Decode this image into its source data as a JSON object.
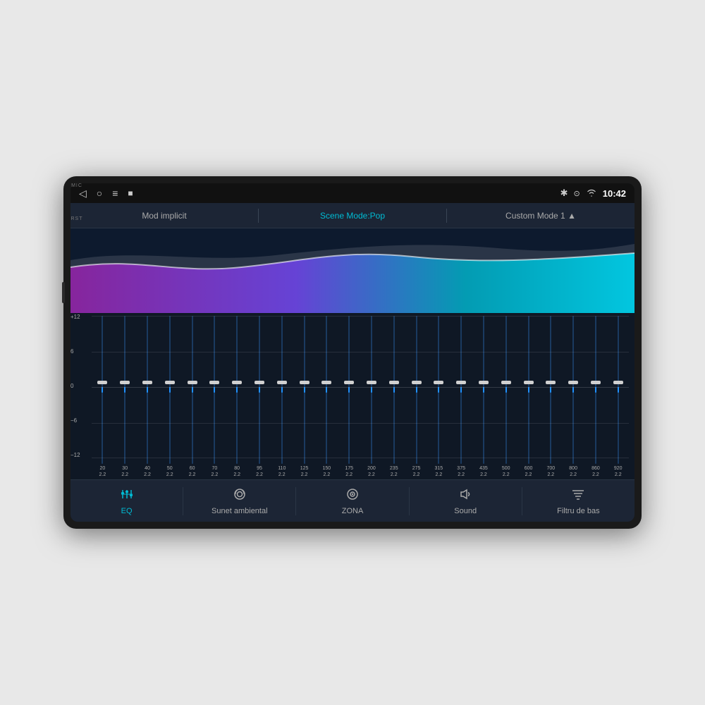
{
  "device": {
    "mic_label": "MIC",
    "rst_label": "RST"
  },
  "status_bar": {
    "time": "10:42",
    "icons": [
      "◁",
      "○",
      "≡",
      "■"
    ],
    "right_icons": [
      "✱",
      "⊙",
      "WiFi"
    ]
  },
  "mode_bar": {
    "items": [
      {
        "label": "Mod implicit",
        "active": false
      },
      {
        "label": "Scene Mode:Pop",
        "active": true
      },
      {
        "label": "Custom Mode 1 ▲",
        "active": false
      }
    ]
  },
  "eq_bands": [
    {
      "fc": "20",
      "q": "2.2",
      "level": 0.5
    },
    {
      "fc": "30",
      "q": "2.2",
      "level": 0.5
    },
    {
      "fc": "40",
      "q": "2.2",
      "level": 0.5
    },
    {
      "fc": "50",
      "q": "2.2",
      "level": 0.5
    },
    {
      "fc": "60",
      "q": "2.2",
      "level": 0.5
    },
    {
      "fc": "70",
      "q": "2.2",
      "level": 0.5
    },
    {
      "fc": "80",
      "q": "2.2",
      "level": 0.5
    },
    {
      "fc": "95",
      "q": "2.2",
      "level": 0.5
    },
    {
      "fc": "110",
      "q": "2.2",
      "level": 0.5
    },
    {
      "fc": "125",
      "q": "2.2",
      "level": 0.5
    },
    {
      "fc": "150",
      "q": "2.2",
      "level": 0.5
    },
    {
      "fc": "175",
      "q": "2.2",
      "level": 0.5
    },
    {
      "fc": "200",
      "q": "2.2",
      "level": 0.5
    },
    {
      "fc": "235",
      "q": "2.2",
      "level": 0.5
    },
    {
      "fc": "275",
      "q": "2.2",
      "level": 0.5
    },
    {
      "fc": "315",
      "q": "2.2",
      "level": 0.5
    },
    {
      "fc": "375",
      "q": "2.2",
      "level": 0.5
    },
    {
      "fc": "435",
      "q": "2.2",
      "level": 0.5
    },
    {
      "fc": "500",
      "q": "2.2",
      "level": 0.5
    },
    {
      "fc": "600",
      "q": "2.2",
      "level": 0.5
    },
    {
      "fc": "700",
      "q": "2.2",
      "level": 0.5
    },
    {
      "fc": "800",
      "q": "2.2",
      "level": 0.5
    },
    {
      "fc": "860",
      "q": "2.2",
      "level": 0.5
    },
    {
      "fc": "920",
      "q": "2.2",
      "level": 0.5
    }
  ],
  "scale_labels": [
    "+12",
    "6",
    "0",
    "−6",
    "−12"
  ],
  "nav_items": [
    {
      "label": "EQ",
      "icon": "sliders",
      "active": true
    },
    {
      "label": "Sunet ambiental",
      "icon": "radio",
      "active": false
    },
    {
      "label": "ZONA",
      "icon": "target",
      "active": false
    },
    {
      "label": "Sound",
      "icon": "speaker",
      "active": false
    },
    {
      "label": "Filtru de bas",
      "icon": "filter",
      "active": false
    }
  ]
}
